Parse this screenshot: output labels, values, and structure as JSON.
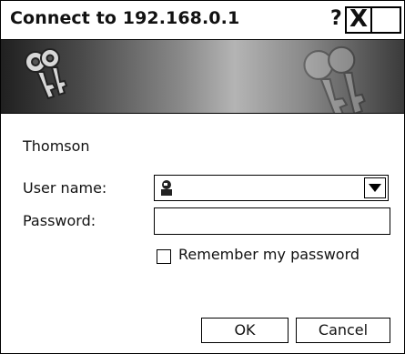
{
  "window": {
    "title": "Connect to 192.168.0.1",
    "help_label": "?",
    "close_label": "X"
  },
  "icons": {
    "banner": "keys-icon",
    "username_prefix": "user-icon",
    "dropdown": "chevron-down-icon"
  },
  "form": {
    "realm": "Thomson",
    "username_label": "User name:",
    "username_value": "",
    "password_label": "Password:",
    "password_value": "",
    "remember_label": "Remember my password",
    "remember_checked": false
  },
  "buttons": {
    "ok": "OK",
    "cancel": "Cancel"
  }
}
